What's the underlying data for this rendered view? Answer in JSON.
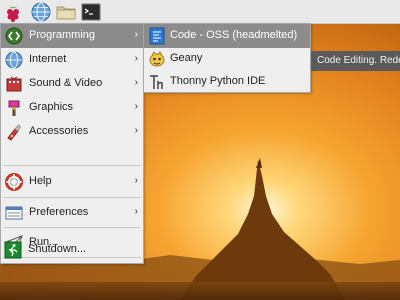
{
  "taskbar": {
    "icons": [
      "raspberry-menu-icon",
      "web-browser-icon",
      "file-manager-icon",
      "terminal-icon"
    ]
  },
  "main_menu": {
    "items": [
      {
        "label": "Programming",
        "icon": "programming-icon",
        "has_submenu": true,
        "selected": true
      },
      {
        "label": "Internet",
        "icon": "internet-globe-icon",
        "has_submenu": true
      },
      {
        "label": "Sound & Video",
        "icon": "sound-video-icon",
        "has_submenu": true
      },
      {
        "label": "Graphics",
        "icon": "graphics-icon",
        "has_submenu": true
      },
      {
        "label": "Accessories",
        "icon": "accessories-knife-icon",
        "has_submenu": true
      },
      {
        "label": "Help",
        "icon": "help-lifebuoy-icon",
        "has_submenu": true
      },
      {
        "label": "Preferences",
        "icon": "preferences-icon",
        "has_submenu": true
      },
      {
        "label": "Run...",
        "icon": "run-paper-plane-icon",
        "has_submenu": false
      },
      {
        "label": "Shutdown...",
        "icon": "shutdown-exit-icon",
        "has_submenu": false
      }
    ],
    "submenu_arrow": "›"
  },
  "programming_submenu": {
    "items": [
      {
        "label": "Code - OSS (headmelted)",
        "icon": "code-oss-icon",
        "selected": true
      },
      {
        "label": "Geany",
        "icon": "geany-icon"
      },
      {
        "label": "Thonny Python IDE",
        "icon": "thonny-icon"
      }
    ]
  },
  "tooltip": {
    "text": "Code Editing. Rede"
  },
  "colors": {
    "selected_bg": "#8c8c8c",
    "menu_bg": "#efefef",
    "tooltip_bg": "#5a5a5a"
  }
}
